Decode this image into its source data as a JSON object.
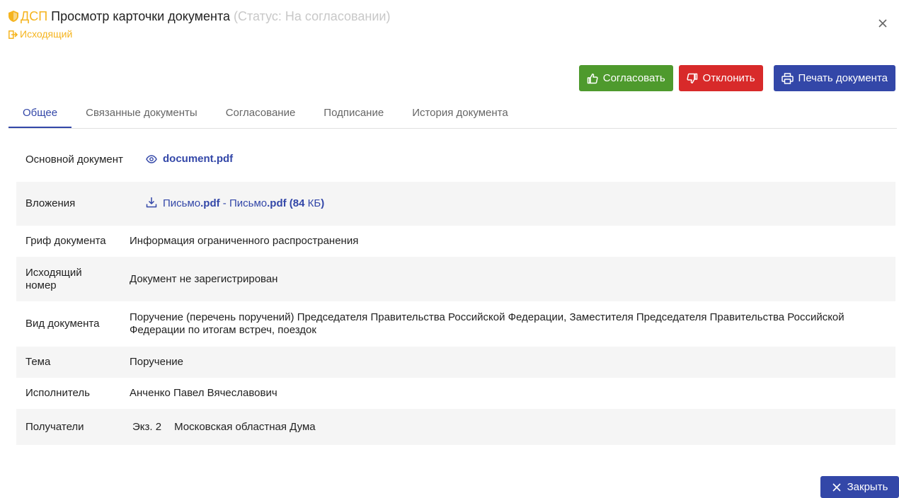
{
  "header": {
    "dsp_label": "ДСП",
    "title": "Просмотр карточки документа",
    "status": "(Статус: На согласовании)",
    "direction": "Исходящий"
  },
  "actions": {
    "approve": "Согласовать",
    "reject": "Отклонить",
    "print": "Печать документа"
  },
  "tabs": [
    {
      "label": "Общее"
    },
    {
      "label": "Связанные документы"
    },
    {
      "label": "Согласование"
    },
    {
      "label": "Подписание"
    },
    {
      "label": "История документа"
    }
  ],
  "fields": {
    "main_doc": {
      "label": "Основной документ",
      "value": "document.pdf"
    },
    "attachments": {
      "label": "Вложения",
      "name1": "Письмо",
      "ext1": ".pdf",
      "sep": " - ",
      "name2": "Письмо",
      "ext2": ".pdf",
      "size_open": " (84 ",
      "size_unit": "КБ",
      "size_close": ")"
    },
    "classification": {
      "label": "Гриф документа",
      "value": "Информация ограниченного распространения"
    },
    "outgoing_number": {
      "label": "Исходящий номер",
      "value": "Документ не зарегистрирован"
    },
    "doc_type": {
      "label": "Вид документа",
      "value": "Поручение (перечень поручений) Председателя Правительства Российской Федерации, Заместителя Председателя Правительства Российской Федерации по итогам встреч, поездок"
    },
    "topic": {
      "label": "Тема",
      "value": "Поручение"
    },
    "executor": {
      "label": "Исполнитель",
      "value": "Анченко Павел Вячеславович"
    },
    "recipients": {
      "label": "Получатели",
      "copy": "Экз. 2",
      "name": "Московская областная Дума"
    }
  },
  "footer": {
    "close": "Закрыть"
  },
  "colors": {
    "accent": "#3347a8",
    "approve": "#4e9a2d",
    "reject": "#d82a2a",
    "dsp": "#f5b41f",
    "status": "#c8c8c8"
  }
}
